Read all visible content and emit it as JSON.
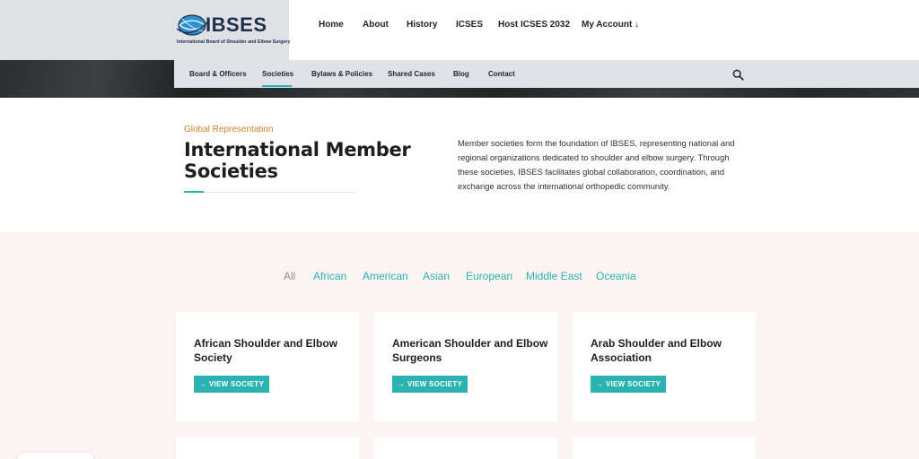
{
  "brand": {
    "name": "IBSES",
    "tagline": "International Board of Shoulder and Elbow Surgery"
  },
  "main_nav": [
    "Home",
    "About",
    "History",
    "ICSES",
    "Host ICSES 2032",
    "My Account ↓"
  ],
  "sub_nav": [
    "Board & Officers",
    "Societies",
    "Bylaws & Policies",
    "Shared Cases",
    "Blog",
    "Contact"
  ],
  "sub_nav_active": "Societies",
  "intro": {
    "eyebrow": "Global Representation",
    "title": "International Member Societies",
    "body": "Member societies form the foundation of IBSES, representing national and regional organizations dedicated to shoulder and elbow surgery. Through these societies, IBSES facilitates global collaboration, coordination, and exchange across the international orthopedic community."
  },
  "filters": [
    "All",
    "African",
    "American",
    "Asian",
    "European",
    "Middle East",
    "Oceania"
  ],
  "active_filter": "All",
  "societies": [
    {
      "name": "African Shoulder and Elbow Society",
      "button": "→ VIEW SOCIETY"
    },
    {
      "name": "American Shoulder and Elbow Surgeons",
      "button": "→ VIEW SOCIETY"
    },
    {
      "name": "Arab Shoulder and Elbow Association",
      "button": "→ VIEW SOCIETY"
    }
  ],
  "colors": {
    "accent": "#2bb3b1",
    "eyebrow": "#c8862b",
    "brand_navy": "#1d2f4b"
  },
  "icons": [
    "globe-logo-icon",
    "search-icon",
    "arrow-right-icon"
  ]
}
